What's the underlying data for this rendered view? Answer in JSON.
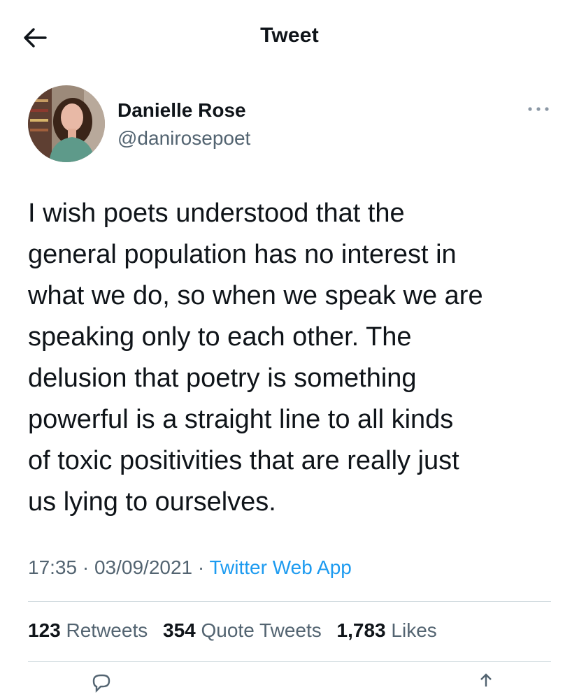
{
  "header": {
    "title": "Tweet",
    "back_icon": "arrow-left-icon"
  },
  "author": {
    "name": "Danielle Rose",
    "handle": "@danirosepoet",
    "more_icon": "more-horizontal-icon"
  },
  "tweet": {
    "text": "I wish poets understood that the\ngeneral population has no interest in\nwhat we do, so when we speak we are\nspeaking only to each other. The\ndelusion that poetry is something\npowerful is a straight line to all kinds\nof toxic positivities that are really just\nus lying to ourselves."
  },
  "meta": {
    "time": "17:35",
    "date": "03/09/2021",
    "separator": "·",
    "source": "Twitter Web App"
  },
  "stats": {
    "retweets": {
      "count": "123",
      "label": "Retweets"
    },
    "quote_tweets": {
      "count": "354",
      "label": "Quote Tweets"
    },
    "likes": {
      "count": "1,783",
      "label": "Likes"
    }
  },
  "colors": {
    "text": "#0f1419",
    "secondary": "#536471",
    "link": "#1d9bf0",
    "divider": "#cfd9de"
  }
}
